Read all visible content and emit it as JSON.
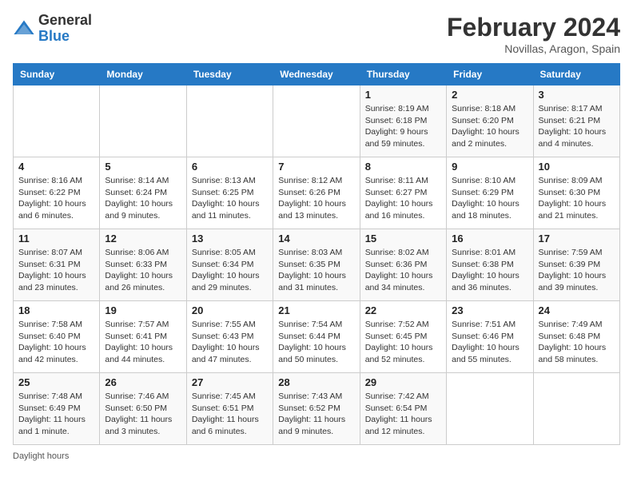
{
  "header": {
    "logo_general": "General",
    "logo_blue": "Blue",
    "month_year": "February 2024",
    "location": "Novillas, Aragon, Spain"
  },
  "days_of_week": [
    "Sunday",
    "Monday",
    "Tuesday",
    "Wednesday",
    "Thursday",
    "Friday",
    "Saturday"
  ],
  "weeks": [
    [
      {
        "day": "",
        "info": ""
      },
      {
        "day": "",
        "info": ""
      },
      {
        "day": "",
        "info": ""
      },
      {
        "day": "",
        "info": ""
      },
      {
        "day": "1",
        "info": "Sunrise: 8:19 AM\nSunset: 6:18 PM\nDaylight: 9 hours and 59 minutes."
      },
      {
        "day": "2",
        "info": "Sunrise: 8:18 AM\nSunset: 6:20 PM\nDaylight: 10 hours and 2 minutes."
      },
      {
        "day": "3",
        "info": "Sunrise: 8:17 AM\nSunset: 6:21 PM\nDaylight: 10 hours and 4 minutes."
      }
    ],
    [
      {
        "day": "4",
        "info": "Sunrise: 8:16 AM\nSunset: 6:22 PM\nDaylight: 10 hours and 6 minutes."
      },
      {
        "day": "5",
        "info": "Sunrise: 8:14 AM\nSunset: 6:24 PM\nDaylight: 10 hours and 9 minutes."
      },
      {
        "day": "6",
        "info": "Sunrise: 8:13 AM\nSunset: 6:25 PM\nDaylight: 10 hours and 11 minutes."
      },
      {
        "day": "7",
        "info": "Sunrise: 8:12 AM\nSunset: 6:26 PM\nDaylight: 10 hours and 13 minutes."
      },
      {
        "day": "8",
        "info": "Sunrise: 8:11 AM\nSunset: 6:27 PM\nDaylight: 10 hours and 16 minutes."
      },
      {
        "day": "9",
        "info": "Sunrise: 8:10 AM\nSunset: 6:29 PM\nDaylight: 10 hours and 18 minutes."
      },
      {
        "day": "10",
        "info": "Sunrise: 8:09 AM\nSunset: 6:30 PM\nDaylight: 10 hours and 21 minutes."
      }
    ],
    [
      {
        "day": "11",
        "info": "Sunrise: 8:07 AM\nSunset: 6:31 PM\nDaylight: 10 hours and 23 minutes."
      },
      {
        "day": "12",
        "info": "Sunrise: 8:06 AM\nSunset: 6:33 PM\nDaylight: 10 hours and 26 minutes."
      },
      {
        "day": "13",
        "info": "Sunrise: 8:05 AM\nSunset: 6:34 PM\nDaylight: 10 hours and 29 minutes."
      },
      {
        "day": "14",
        "info": "Sunrise: 8:03 AM\nSunset: 6:35 PM\nDaylight: 10 hours and 31 minutes."
      },
      {
        "day": "15",
        "info": "Sunrise: 8:02 AM\nSunset: 6:36 PM\nDaylight: 10 hours and 34 minutes."
      },
      {
        "day": "16",
        "info": "Sunrise: 8:01 AM\nSunset: 6:38 PM\nDaylight: 10 hours and 36 minutes."
      },
      {
        "day": "17",
        "info": "Sunrise: 7:59 AM\nSunset: 6:39 PM\nDaylight: 10 hours and 39 minutes."
      }
    ],
    [
      {
        "day": "18",
        "info": "Sunrise: 7:58 AM\nSunset: 6:40 PM\nDaylight: 10 hours and 42 minutes."
      },
      {
        "day": "19",
        "info": "Sunrise: 7:57 AM\nSunset: 6:41 PM\nDaylight: 10 hours and 44 minutes."
      },
      {
        "day": "20",
        "info": "Sunrise: 7:55 AM\nSunset: 6:43 PM\nDaylight: 10 hours and 47 minutes."
      },
      {
        "day": "21",
        "info": "Sunrise: 7:54 AM\nSunset: 6:44 PM\nDaylight: 10 hours and 50 minutes."
      },
      {
        "day": "22",
        "info": "Sunrise: 7:52 AM\nSunset: 6:45 PM\nDaylight: 10 hours and 52 minutes."
      },
      {
        "day": "23",
        "info": "Sunrise: 7:51 AM\nSunset: 6:46 PM\nDaylight: 10 hours and 55 minutes."
      },
      {
        "day": "24",
        "info": "Sunrise: 7:49 AM\nSunset: 6:48 PM\nDaylight: 10 hours and 58 minutes."
      }
    ],
    [
      {
        "day": "25",
        "info": "Sunrise: 7:48 AM\nSunset: 6:49 PM\nDaylight: 11 hours and 1 minute."
      },
      {
        "day": "26",
        "info": "Sunrise: 7:46 AM\nSunset: 6:50 PM\nDaylight: 11 hours and 3 minutes."
      },
      {
        "day": "27",
        "info": "Sunrise: 7:45 AM\nSunset: 6:51 PM\nDaylight: 11 hours and 6 minutes."
      },
      {
        "day": "28",
        "info": "Sunrise: 7:43 AM\nSunset: 6:52 PM\nDaylight: 11 hours and 9 minutes."
      },
      {
        "day": "29",
        "info": "Sunrise: 7:42 AM\nSunset: 6:54 PM\nDaylight: 11 hours and 12 minutes."
      },
      {
        "day": "",
        "info": ""
      },
      {
        "day": "",
        "info": ""
      }
    ]
  ],
  "footer": {
    "daylight_hours": "Daylight hours"
  }
}
